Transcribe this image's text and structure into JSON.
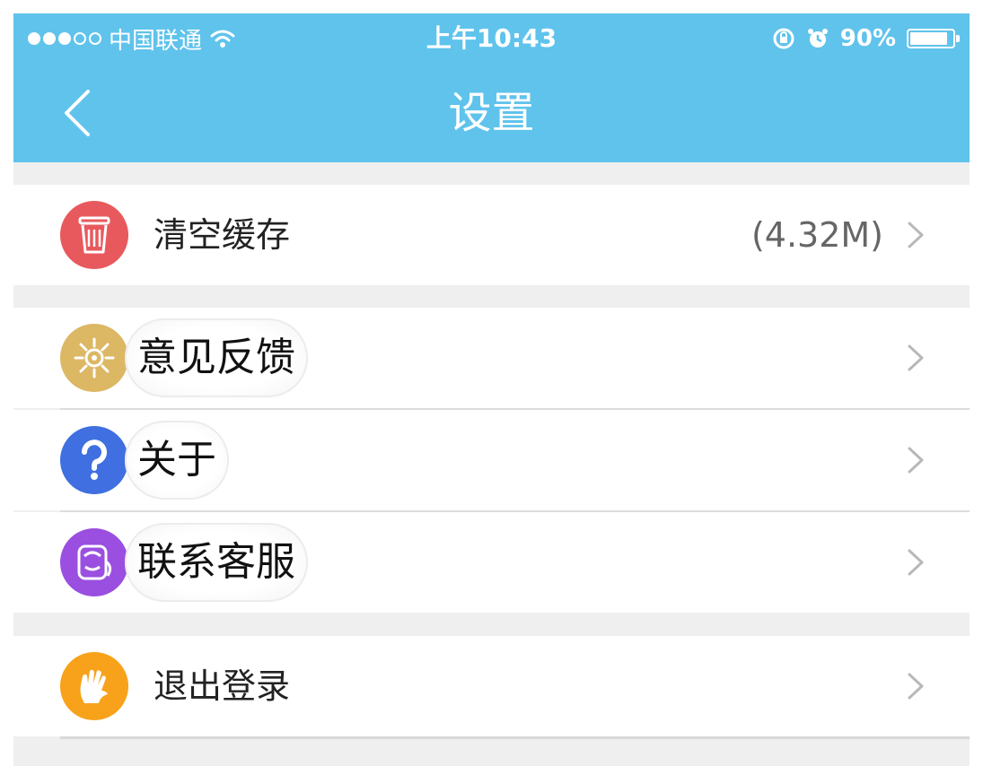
{
  "status_bar": {
    "carrier": "中国联通",
    "time": "上午10:43",
    "battery": "90%",
    "battery_level": 0.9,
    "icons": [
      "signal-dots-icon",
      "wifi-icon",
      "rotation-lock-icon",
      "alarm-icon",
      "battery-icon"
    ]
  },
  "nav": {
    "title": "设置",
    "back_icon": "chevron-left-icon"
  },
  "colors": {
    "header": "#5fc3ec",
    "background": "#efefef",
    "clear_cache_icon": "#e8595d",
    "feedback_icon": "#dcb764",
    "about_icon": "#3f6fe0",
    "support_icon": "#9a4fe0",
    "logout_icon": "#f7a21a"
  },
  "settings": {
    "clear_cache": {
      "label": "清空缓存",
      "value": "(4.32M)",
      "icon": "trash-icon"
    },
    "feedback": {
      "label": "意见反馈",
      "icon": "feedback-icon"
    },
    "about": {
      "label": "关于",
      "icon": "question-icon"
    },
    "support": {
      "label": "联系客服",
      "icon": "customer-service-icon"
    },
    "logout": {
      "label": "退出登录",
      "icon": "wave-hand-icon"
    }
  }
}
